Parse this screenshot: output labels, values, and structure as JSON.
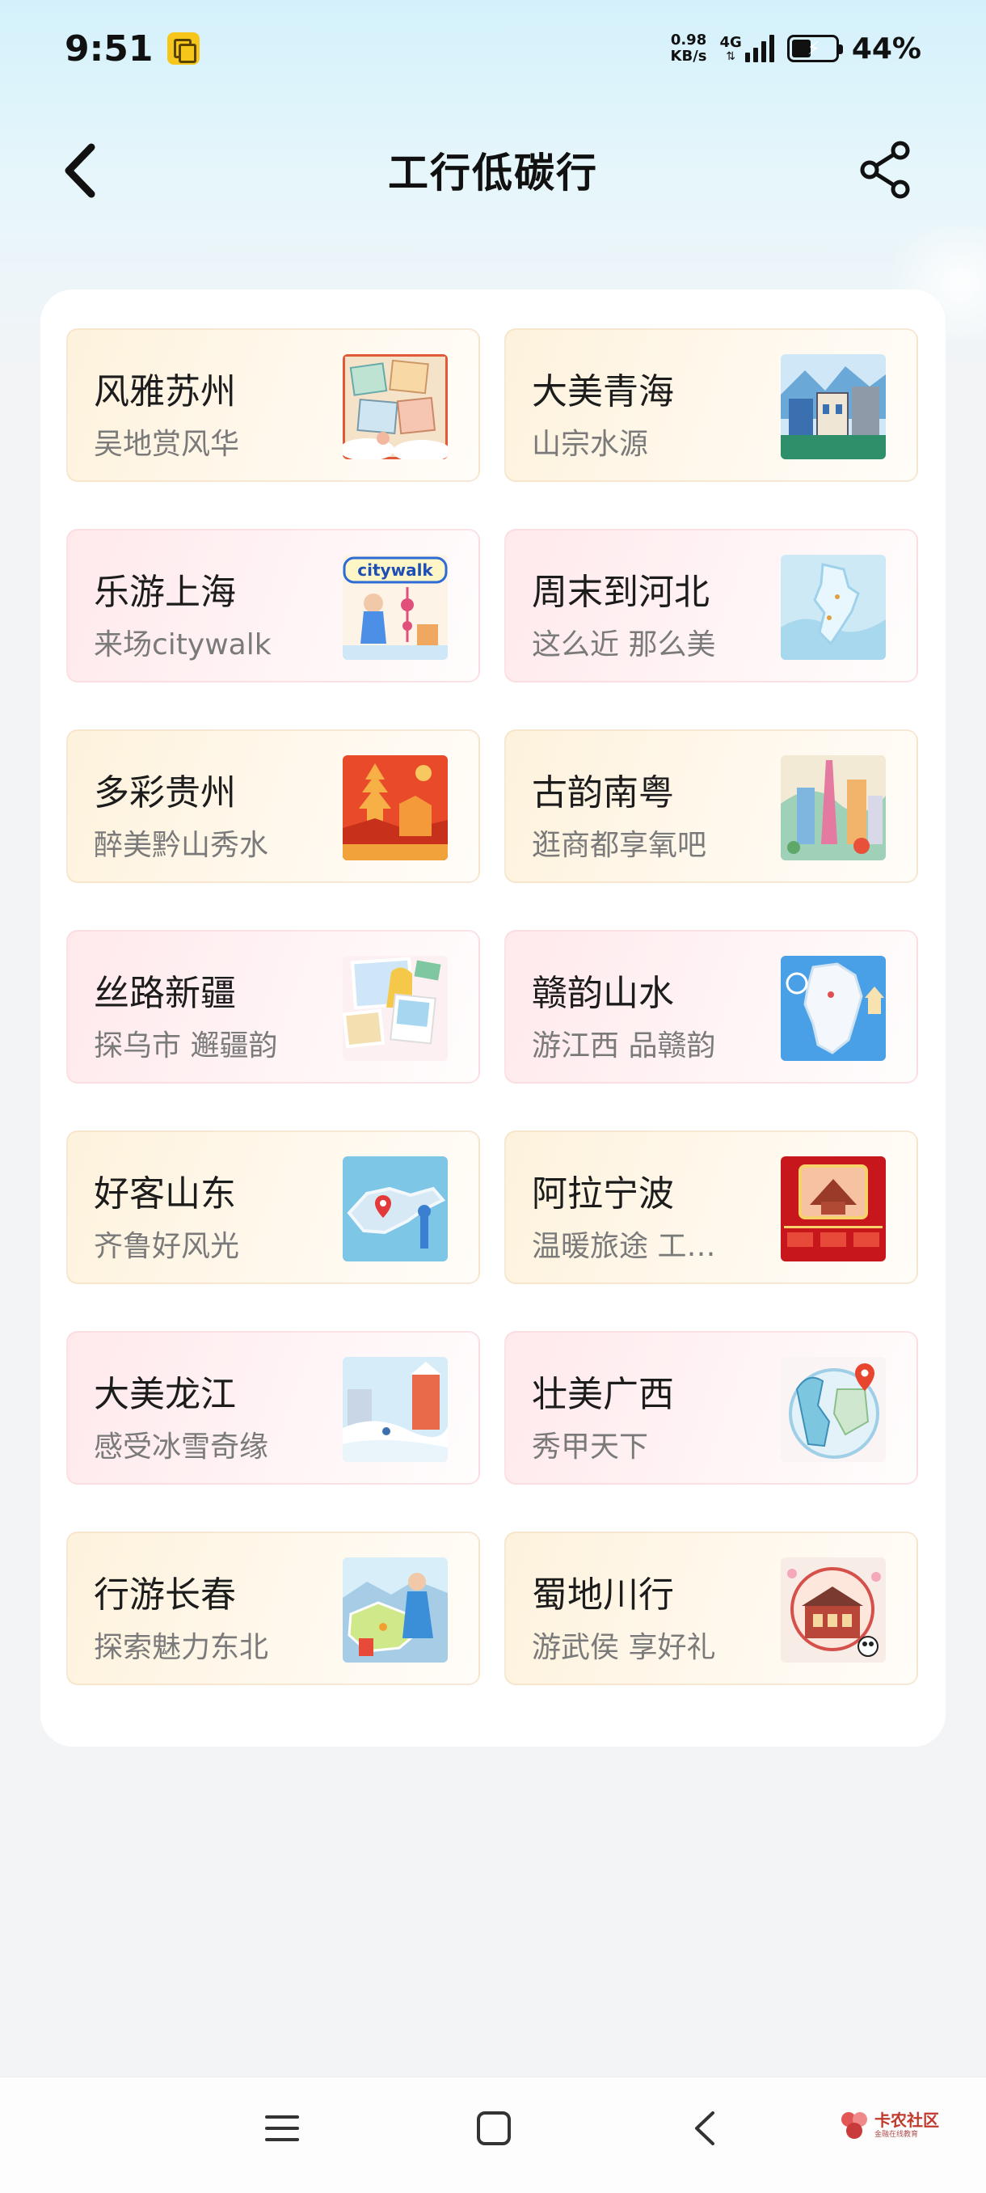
{
  "status_bar": {
    "time": "9:51",
    "net_speed_value": "0.98",
    "net_speed_unit": "KB/s",
    "network_type": "4G",
    "battery_percent": "44%",
    "battery_level": 0.44
  },
  "header": {
    "title": "工行低碳行",
    "back_icon": "chevron-left-icon",
    "share_icon": "share-icon"
  },
  "destinations": [
    {
      "title": "风雅苏州",
      "subtitle": "吴地赏风华",
      "style": "warm"
    },
    {
      "title": "大美青海",
      "subtitle": "山宗水源",
      "style": "warm"
    },
    {
      "title": "乐游上海",
      "subtitle": "来场citywalk",
      "style": "pink",
      "thumb_text": "citywalk"
    },
    {
      "title": "周末到河北",
      "subtitle": "这么近 那么美",
      "style": "pink"
    },
    {
      "title": "多彩贵州",
      "subtitle": "醉美黔山秀水",
      "style": "warm"
    },
    {
      "title": "古韵南粤",
      "subtitle": "逛商都享氧吧",
      "style": "warm"
    },
    {
      "title": "丝路新疆",
      "subtitle": "探乌市 邂疆韵",
      "style": "pink"
    },
    {
      "title": "赣韵山水",
      "subtitle": "游江西 品赣韵",
      "style": "pink"
    },
    {
      "title": "好客山东",
      "subtitle": "齐鲁好风光",
      "style": "warm"
    },
    {
      "title": "阿拉宁波",
      "subtitle": "温暖旅途 工…",
      "style": "warm"
    },
    {
      "title": "大美龙江",
      "subtitle": "感受冰雪奇缘",
      "style": "pink"
    },
    {
      "title": "壮美广西",
      "subtitle": "秀甲天下",
      "style": "pink"
    },
    {
      "title": "行游长春",
      "subtitle": "探索魅力东北",
      "style": "warm"
    },
    {
      "title": "蜀地川行",
      "subtitle": "游武侯 享好礼",
      "style": "warm"
    }
  ],
  "bottom_nav": {
    "menu_icon": "menu-icon",
    "home_icon": "home-square-icon",
    "back_icon": "back-triangle-icon"
  },
  "watermark": {
    "main": "卡农社区",
    "sub": "金融在线教育"
  }
}
